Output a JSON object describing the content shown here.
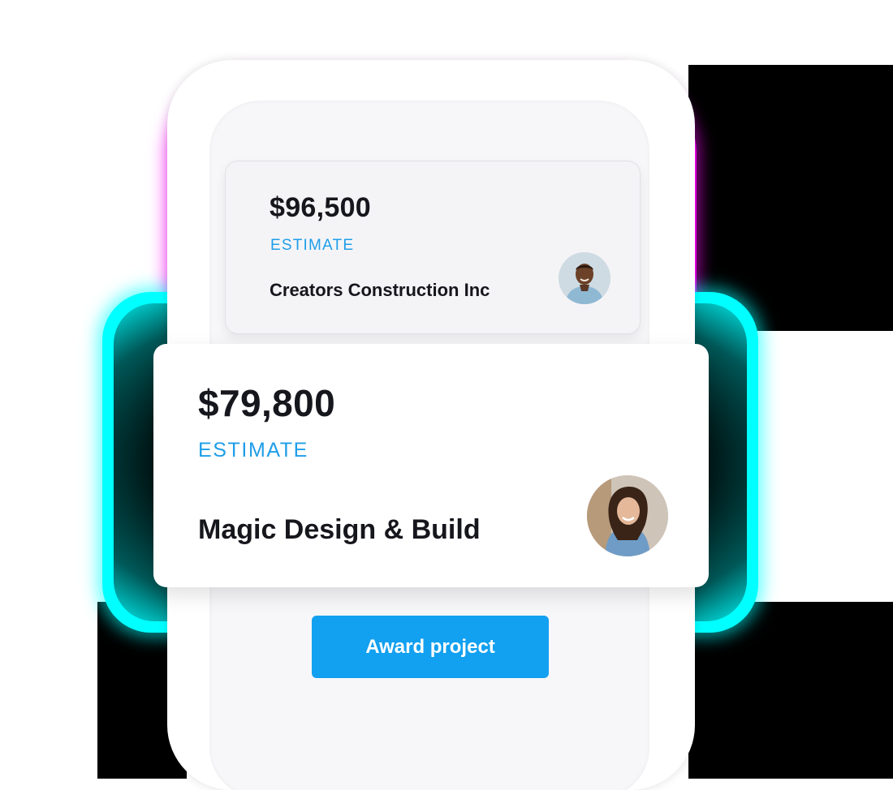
{
  "colors": {
    "accent": "#1f9ee8",
    "button": "#12a0f0",
    "magenta_glow": "#ff00ff",
    "cyan_glow": "#00ffff",
    "text_dark": "#16161d"
  },
  "cards": [
    {
      "amount": "$96,500",
      "label": "ESTIMATE",
      "company": "Creators Construction Inc",
      "avatar": "avatar-man-icon"
    },
    {
      "amount": "$79,800",
      "label": "ESTIMATE",
      "company": "Magic Design & Build",
      "avatar": "avatar-woman-icon"
    }
  ],
  "actions": {
    "award_label": "Award project"
  }
}
